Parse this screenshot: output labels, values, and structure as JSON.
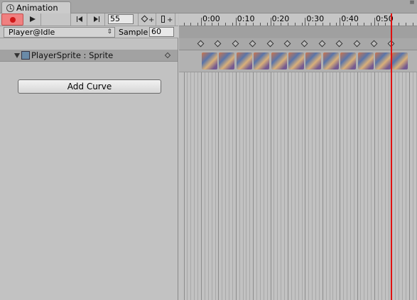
{
  "window": {
    "tab_title": "Animation",
    "menu_glyph": "≡"
  },
  "toolbar": {
    "record_icon": "record-icon",
    "play_icon": "play-icon",
    "prev_key_icon": "prev-keyframe-icon",
    "next_key_icon": "next-keyframe-icon",
    "frame_value": "55",
    "add_keyframe_icon": "add-keyframe-icon",
    "add_event_icon": "add-event-icon",
    "record_active": true
  },
  "clip": {
    "selected": "Player@Idle",
    "sample_label": "Sample",
    "sample_value": "60"
  },
  "hierarchy": {
    "property_label": "PlayerSprite : Sprite",
    "add_curve_label": "Add Curve"
  },
  "timeline": {
    "tick_labels": [
      "0:00",
      "0:10",
      "0:20",
      "0:30",
      "0:40",
      "0:50"
    ],
    "keyframe_count": 12,
    "current_frame": 55,
    "colors": {
      "playhead": "#e01010",
      "record": "#f08080"
    }
  }
}
